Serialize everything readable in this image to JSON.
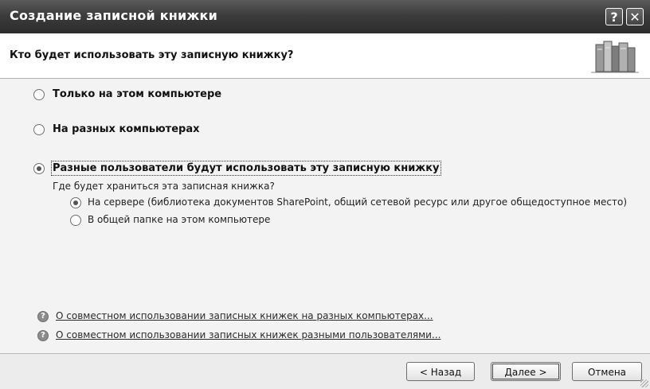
{
  "window": {
    "title": "Создание записной книжки",
    "help_icon": "?",
    "close_icon": "✕"
  },
  "header": {
    "question": "Кто будет использовать эту записную книжку?",
    "icon": "books-icon"
  },
  "options": {
    "this_computer": "Только на этом компьютере",
    "different_computers": "На разных компьютерах",
    "multiple_users": "Разные пользователи будут использовать эту записную книжку",
    "selected": "multiple_users"
  },
  "storage": {
    "question": "Где будет храниться эта записная книжка?",
    "server": "На сервере (библиотека документов SharePoint, общий сетевой ресурс или другое общедоступное место)",
    "shared_folder": "В общей папке на этом компьютере",
    "selected": "server"
  },
  "help_links": {
    "link1": "О совместном использовании записных книжек на разных компьютерах...",
    "link2": "О совместном использовании записных книжек разными пользователями..."
  },
  "buttons": {
    "back": "< Назад",
    "next": "Далее >",
    "cancel": "Отмена"
  },
  "colors": {
    "titlebar": "#3c3c3c",
    "content_bg": "#f3f3f3",
    "header_bg": "#ffffff"
  }
}
